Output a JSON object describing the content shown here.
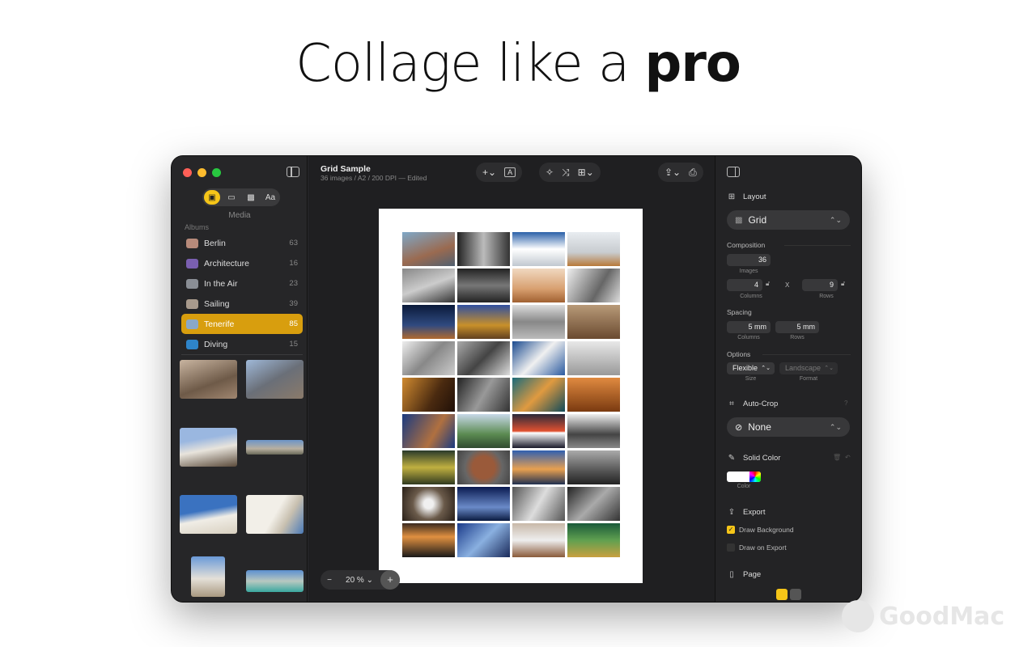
{
  "headline": {
    "light": "Collage like a ",
    "bold": "pro"
  },
  "colors": {
    "accent": "#f5c518",
    "selected_album": "#d89e0e",
    "red": "#ff5f57",
    "yellow": "#febc2e",
    "green": "#28c840"
  },
  "sidebar": {
    "segments": [
      "photo-icon",
      "frame-icon",
      "pattern-icon",
      "Aa"
    ],
    "media_label": "Media",
    "albums_label": "Albums",
    "albums": [
      {
        "name": "Berlin",
        "count": "63",
        "color": "#b78a7a"
      },
      {
        "name": "Architecture",
        "count": "16",
        "color": "#7a5fb0"
      },
      {
        "name": "In the Air",
        "count": "23",
        "color": "#8a8e95"
      },
      {
        "name": "Sailing",
        "count": "39",
        "color": "#a89a8c"
      },
      {
        "name": "Tenerife",
        "count": "85",
        "color": "#8aa8c8",
        "selected": true
      },
      {
        "name": "Diving",
        "count": "15",
        "color": "#2e84c9"
      }
    ]
  },
  "document": {
    "title": "Grid Sample",
    "subtitle": "36 images / A2 / 200 DPI — Edited",
    "zoom": "20 %"
  },
  "inspector": {
    "layout_title": "Layout",
    "layout_value": "Grid",
    "composition_title": "Composition",
    "images_value": "36",
    "images_label": "Images",
    "columns_value": "4",
    "columns_label": "Columns",
    "x_label": "X",
    "rows_value": "9",
    "rows_label": "Rows",
    "spacing_title": "Spacing",
    "spacing_columns": "5 mm",
    "spacing_rows": "5 mm",
    "spacing_columns_label": "Columns",
    "spacing_rows_label": "Rows",
    "options_title": "Options",
    "size_value": "Flexible",
    "size_label": "Size",
    "format_value": "Landscape",
    "format_label": "Format",
    "autocrop_title": "Auto-Crop",
    "autocrop_value": "None",
    "solid_title": "Solid Color",
    "color_label": "Color",
    "export_title": "Export",
    "draw_background": "Draw Background",
    "draw_on_export": "Draw on Export",
    "page_title": "Page"
  },
  "watermark": "GoodMac"
}
